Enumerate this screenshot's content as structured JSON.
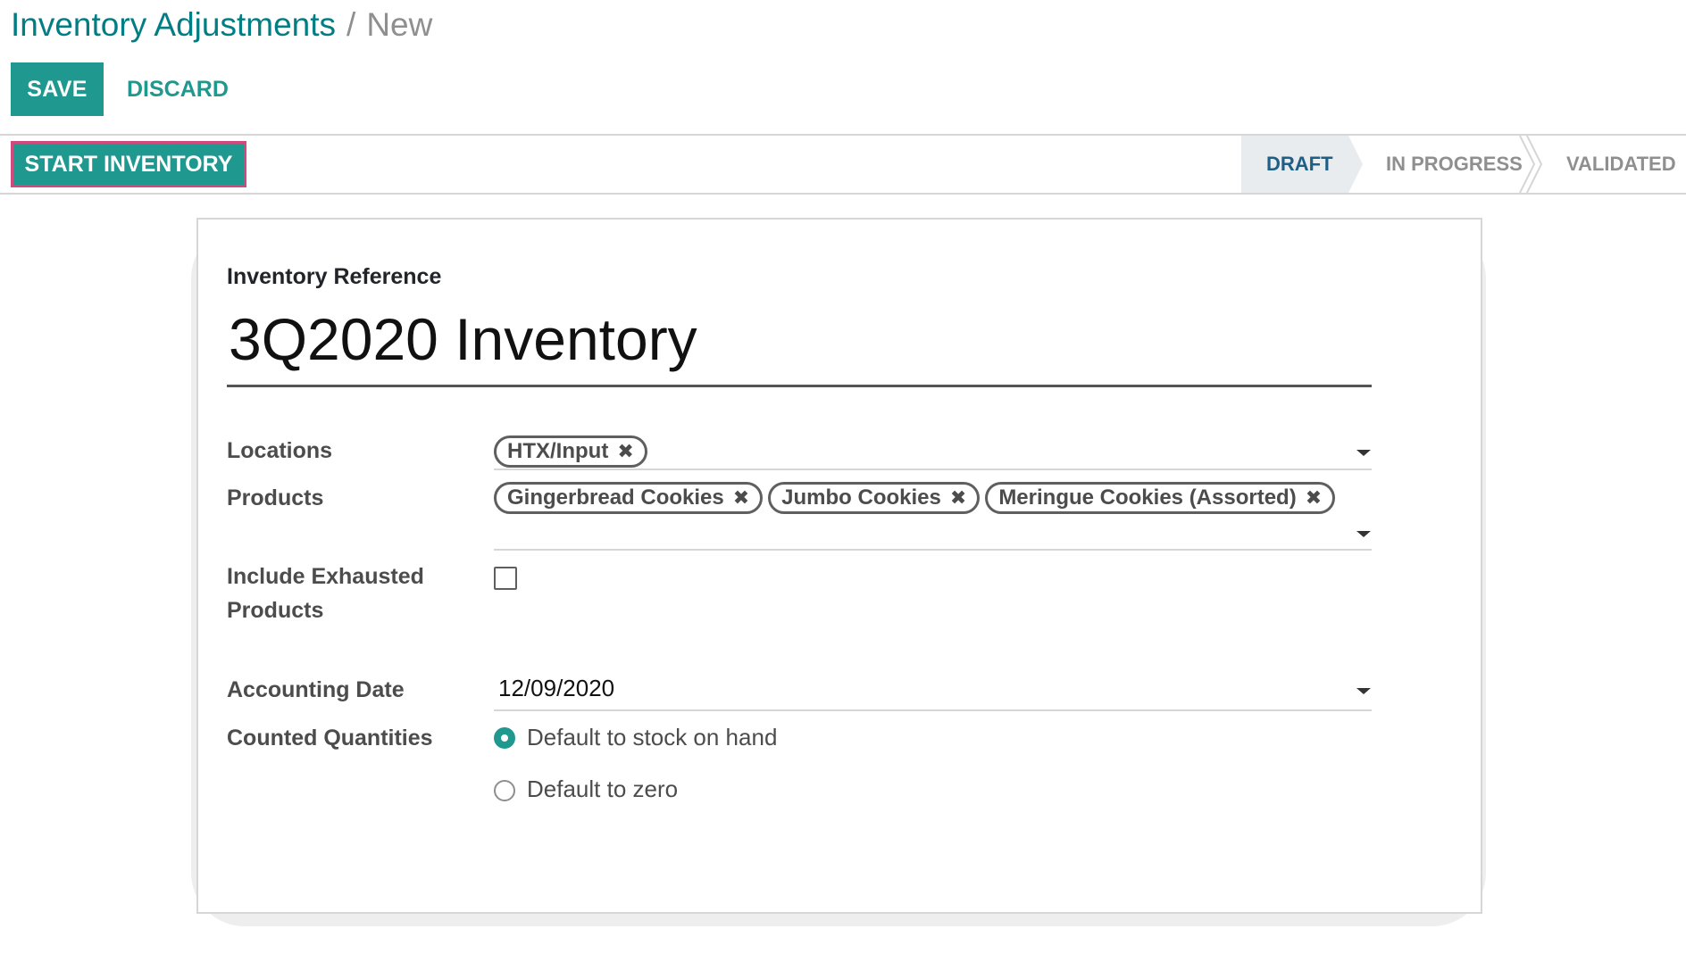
{
  "breadcrumb": {
    "parent": "Inventory Adjustments",
    "separator": "/",
    "current": "New"
  },
  "controls": {
    "save_label": "SAVE",
    "discard_label": "DISCARD"
  },
  "statusbar": {
    "action_label": "START INVENTORY",
    "stages": [
      {
        "label": "DRAFT",
        "active": true
      },
      {
        "label": "IN PROGRESS",
        "active": false
      },
      {
        "label": "VALIDATED",
        "active": false
      }
    ]
  },
  "form": {
    "reference": {
      "label": "Inventory Reference",
      "value": "3Q2020 Inventory"
    },
    "locations": {
      "label": "Locations",
      "tags": [
        "HTX/Input"
      ]
    },
    "products": {
      "label": "Products",
      "tags": [
        "Gingerbread Cookies",
        "Jumbo Cookies",
        "Meringue Cookies (Assorted)"
      ]
    },
    "include_exhausted": {
      "label_line1": "Include Exhausted",
      "label_line2": "Products",
      "checked": false
    },
    "accounting_date": {
      "label": "Accounting Date",
      "value": "12/09/2020"
    },
    "counted_quantities": {
      "label": "Counted Quantities",
      "options": [
        {
          "label": "Default to stock on hand",
          "selected": true
        },
        {
          "label": "Default to zero",
          "selected": false
        }
      ]
    }
  },
  "colors": {
    "primary": "#1f9890",
    "link": "#017e84",
    "highlight_border": "#d14a7e",
    "active_stage": "#1f5f86",
    "inactive_stage": "#8f8f8f"
  },
  "icons": {
    "tag_remove": "close-icon",
    "dropdown": "caret-down-icon"
  }
}
